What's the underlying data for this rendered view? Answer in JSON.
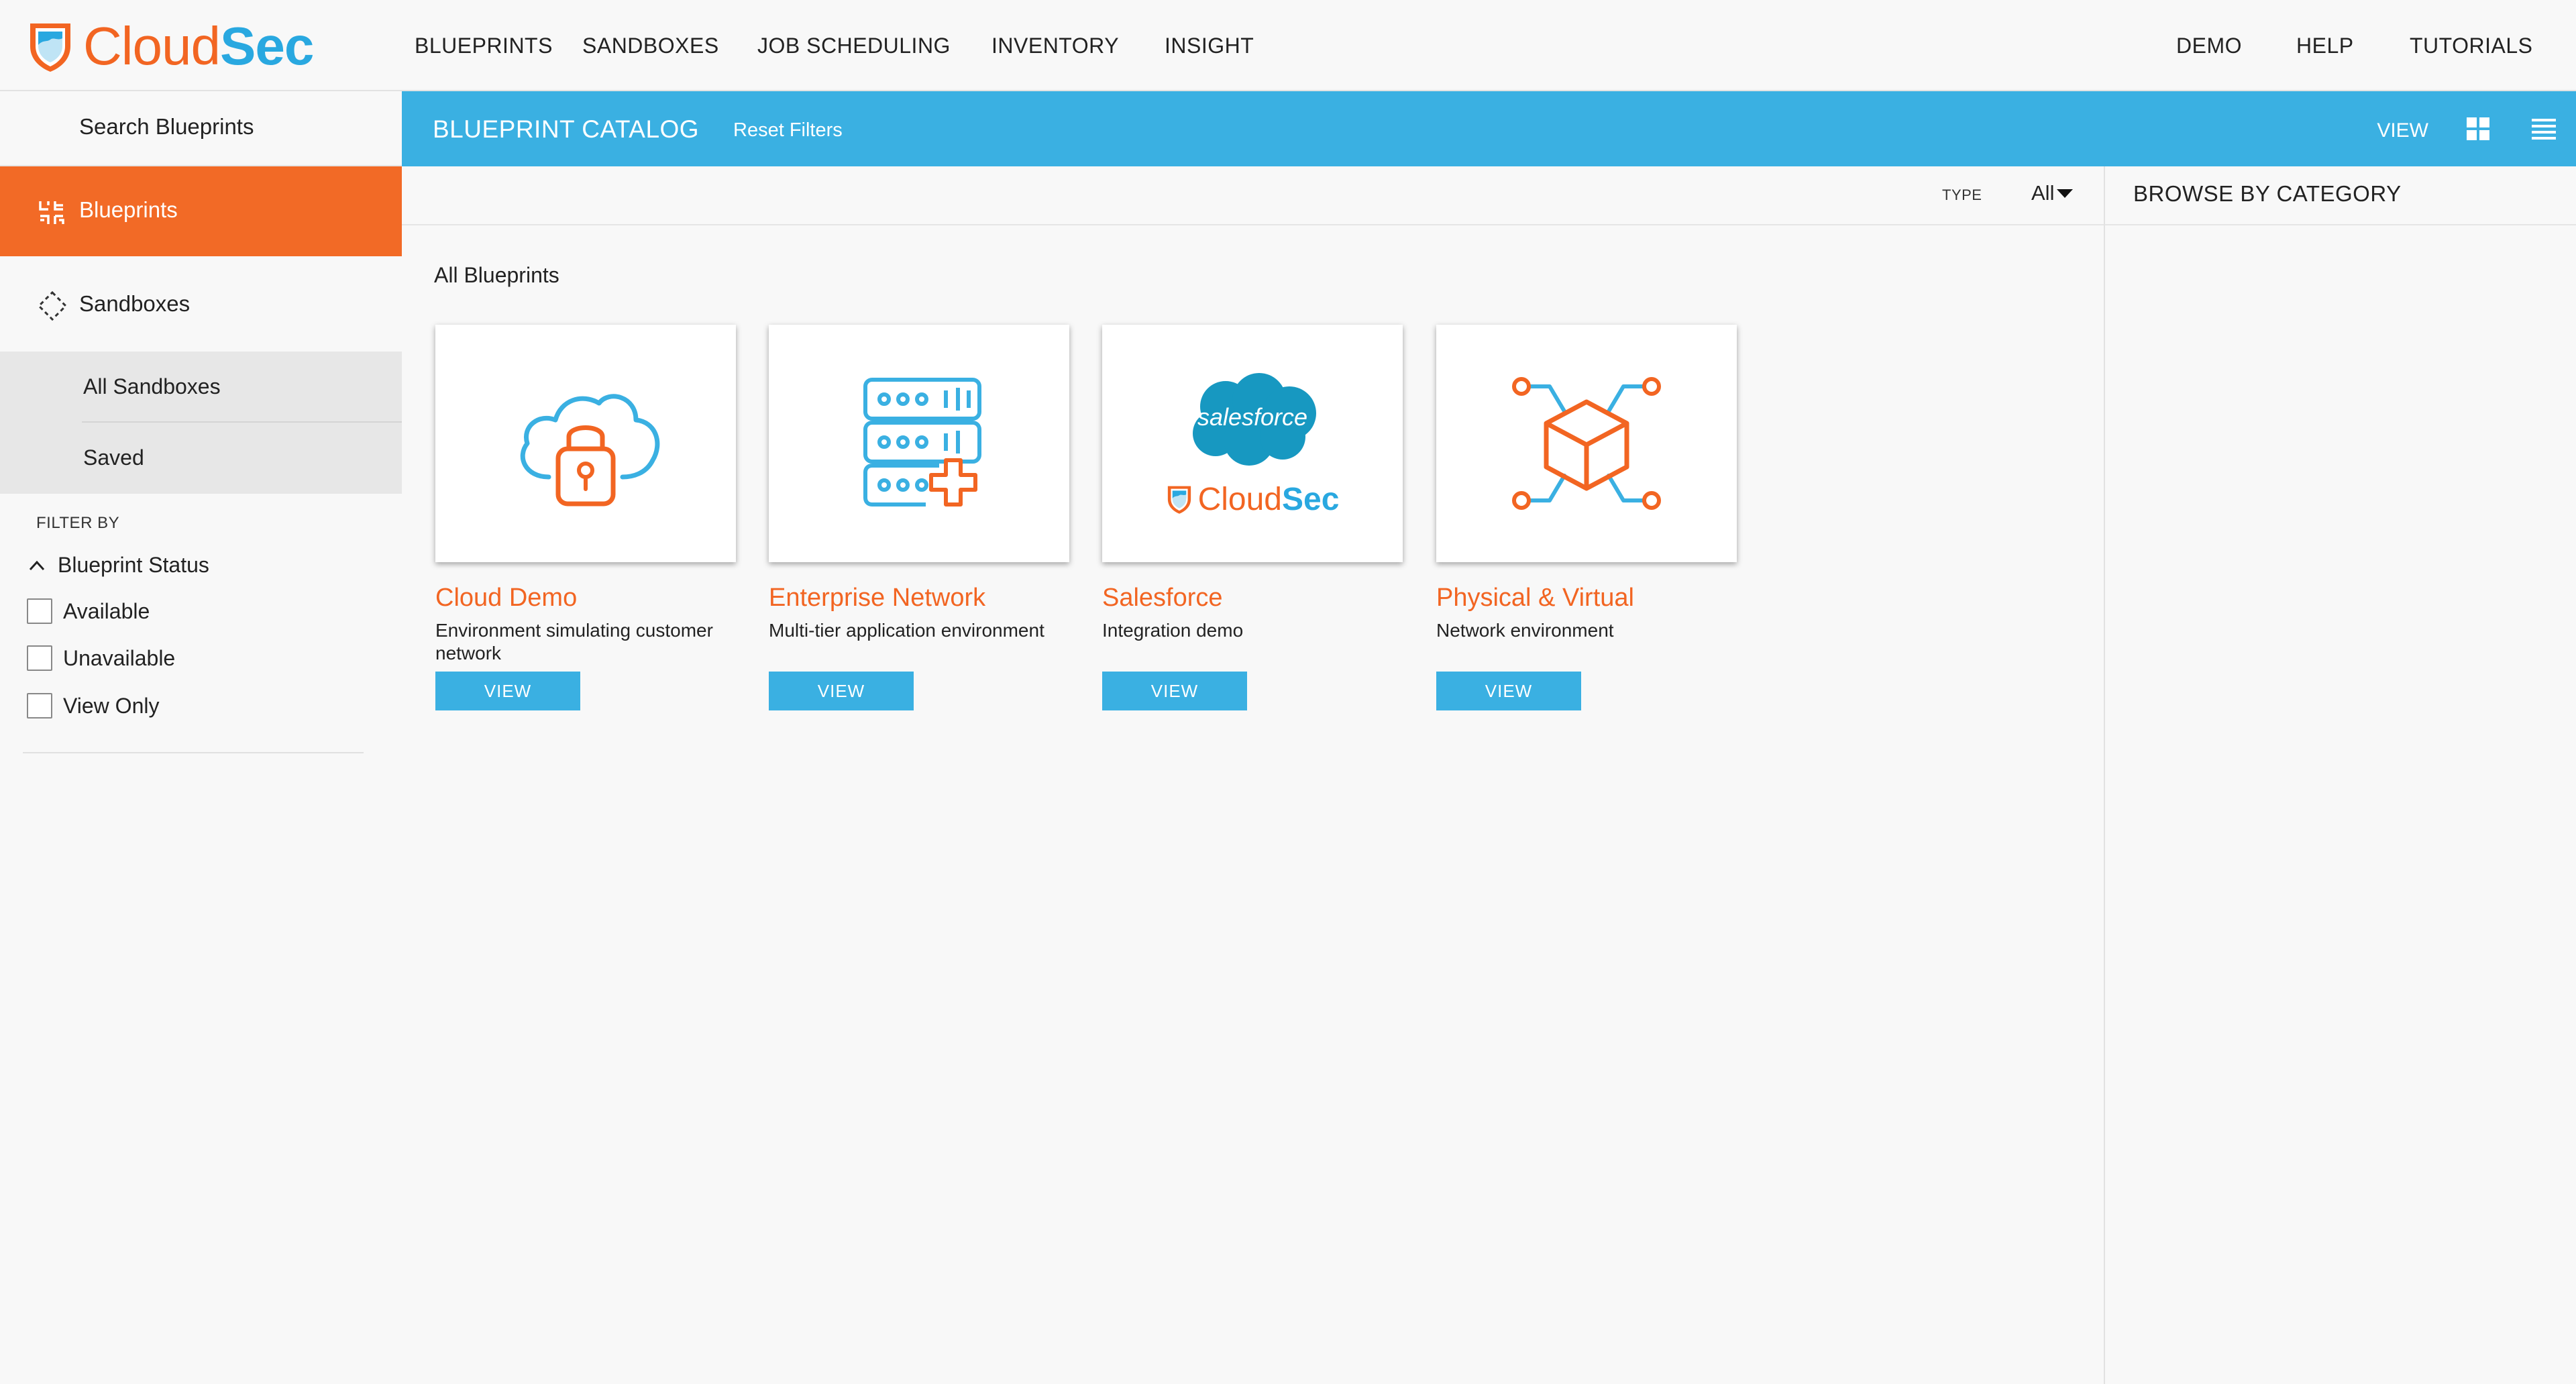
{
  "logo": {
    "part1": "Cloud",
    "part2": "Sec"
  },
  "nav": {
    "left": [
      "BLUEPRINTS",
      "SANDBOXES",
      "JOB SCHEDULING",
      "INVENTORY",
      "INSIGHT"
    ],
    "right": [
      "DEMO",
      "HELP",
      "TUTORIALS"
    ]
  },
  "sidebar": {
    "search_label": "Search Blueprints",
    "blueprints_label": "Blueprints",
    "sandboxes_label": "Sandboxes",
    "sandbox_items": [
      "All Sandboxes",
      "Saved"
    ],
    "filter_title": "FILTER BY",
    "status_group": "Blueprint Status",
    "status_options": [
      "Available",
      "Unavailable",
      "View Only"
    ]
  },
  "header": {
    "title": "BLUEPRINT CATALOG",
    "reset": "Reset Filters",
    "view_label": "VIEW"
  },
  "toolbar": {
    "type_label": "TYPE",
    "type_value": "All"
  },
  "category": {
    "title": "BROWSE BY CATEGORY"
  },
  "content": {
    "section_title": "All Blueprints",
    "cards": [
      {
        "title": "Cloud Demo",
        "desc": "Environment simulating customer network",
        "button": "VIEW",
        "icon": "cloud-lock-icon"
      },
      {
        "title": "Enterprise Network",
        "desc": "Multi-tier application environment",
        "button": "VIEW",
        "icon": "server-plus-icon"
      },
      {
        "title": "Salesforce",
        "desc": "Integration demo",
        "button": "VIEW",
        "icon": "salesforce-logo",
        "logo_text": "salesforce",
        "brand_part1": "Cloud",
        "brand_part2": "Sec"
      },
      {
        "title": "Physical & Virtual",
        "desc": "Network environment",
        "button": "VIEW",
        "icon": "cube-network-icon"
      }
    ]
  },
  "colors": {
    "accent_orange": "#f26522",
    "accent_blue": "#3ab0e2",
    "sidebar_active": "#f26a26"
  }
}
